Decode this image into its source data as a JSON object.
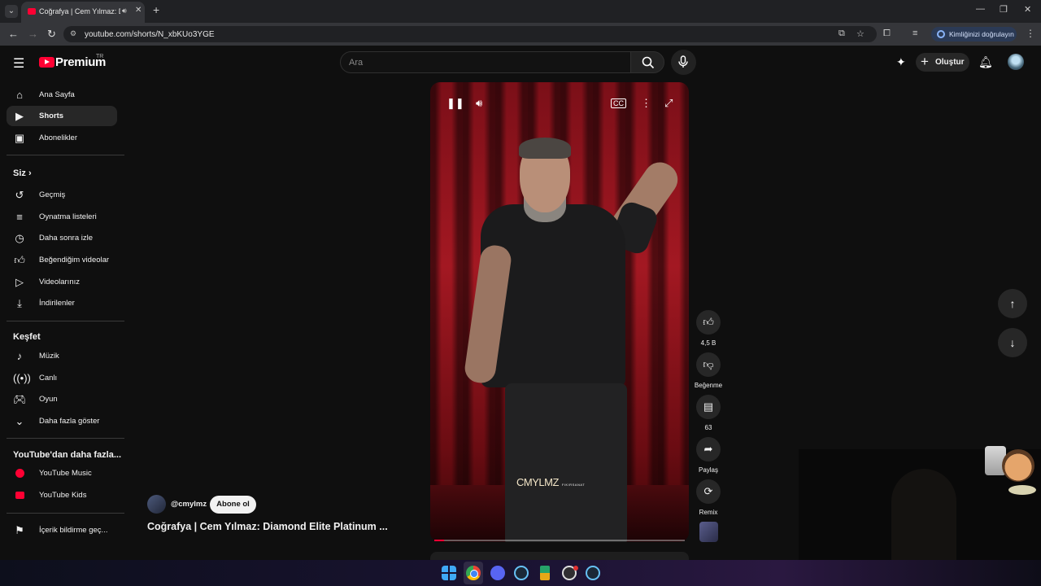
{
  "browser": {
    "tab_title": "Coğrafya | Cem Yılmaz: Dia",
    "url": "youtube.com/shorts/N_xbKUo3YGE",
    "verify_label": "Kimliğinizi doğrulayın"
  },
  "header": {
    "logo_text": "Premium",
    "country": "TR",
    "search_placeholder": "Ara",
    "create_label": "Oluştur"
  },
  "sidebar": {
    "main": [
      {
        "label": "Ana Sayfa",
        "icon": "home-icon"
      },
      {
        "label": "Shorts",
        "icon": "shorts-icon"
      },
      {
        "label": "Abonelikler",
        "icon": "subscriptions-icon"
      }
    ],
    "you_heading": "Siz",
    "you": [
      {
        "label": "Geçmiş",
        "icon": "history-icon"
      },
      {
        "label": "Oynatma listeleri",
        "icon": "playlists-icon"
      },
      {
        "label": "Daha sonra izle",
        "icon": "watch-later-icon"
      },
      {
        "label": "Beğendiğim videolar",
        "icon": "liked-icon"
      },
      {
        "label": "Videolarınız",
        "icon": "your-videos-icon"
      },
      {
        "label": "İndirilenler",
        "icon": "downloads-icon"
      }
    ],
    "explore_heading": "Keşfet",
    "explore": [
      {
        "label": "Müzik",
        "icon": "music-icon"
      },
      {
        "label": "Canlı",
        "icon": "live-icon"
      },
      {
        "label": "Oyun",
        "icon": "gaming-icon"
      },
      {
        "label": "Daha fazla göster",
        "icon": "chevron-down-icon"
      }
    ],
    "more_heading": "YouTube'dan daha fazla...",
    "more": [
      {
        "label": "YouTube Music",
        "icon": "youtube-music-icon"
      },
      {
        "label": "YouTube Kids",
        "icon": "youtube-kids-icon"
      }
    ],
    "report_label": "İçerik bildirme geç..."
  },
  "short": {
    "watermark": "CMYLMZ",
    "watermark_sub": "FIKIRSANAT",
    "channel": "@cmylmz",
    "subscribe_label": "Abone ol",
    "title": "Coğrafya | Cem Yılmaz: Diamond Elite Platinum ...",
    "progress": 0.04,
    "actions": {
      "like_count": "4,5 B",
      "dislike_label": "Beğenme",
      "comment_count": "63",
      "share_label": "Paylaş",
      "remix_label": "Remix"
    }
  },
  "colors": {
    "accent": "#ff0033",
    "background": "#0f0f0f"
  }
}
